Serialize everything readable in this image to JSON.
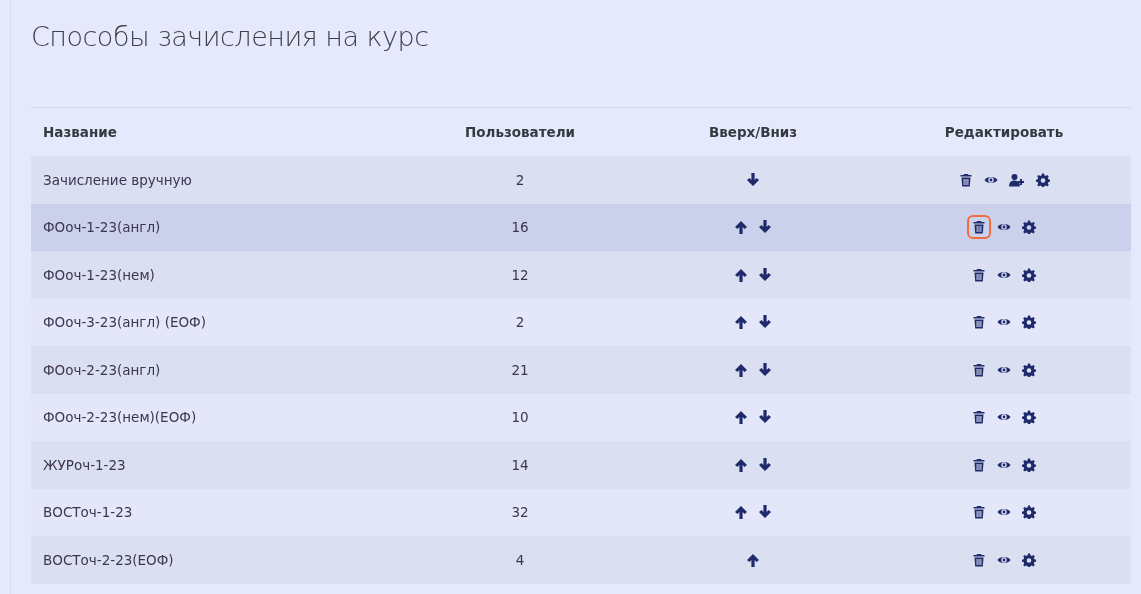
{
  "page_title": "Способы зачисления на курс",
  "table": {
    "columns": [
      "Название",
      "Пользователи",
      "Вверх/Вниз",
      "Редактировать"
    ],
    "rows": [
      {
        "name": "Зачисление вручную",
        "users": "2",
        "hovered": false,
        "moves": [
          {
            "kind": "down"
          }
        ],
        "actions": [
          {
            "kind": "delete",
            "highlighted": false
          },
          {
            "kind": "view",
            "highlighted": false
          },
          {
            "kind": "enrol",
            "highlighted": false
          },
          {
            "kind": "settings",
            "highlighted": false
          }
        ]
      },
      {
        "name": "ФОоч-1-23(англ)",
        "users": "16",
        "hovered": true,
        "moves": [
          {
            "kind": "up"
          },
          {
            "kind": "down"
          }
        ],
        "actions": [
          {
            "kind": "delete",
            "highlighted": true
          },
          {
            "kind": "view",
            "highlighted": false
          },
          {
            "kind": "settings",
            "highlighted": false
          }
        ]
      },
      {
        "name": "ФОоч-1-23(нем)",
        "users": "12",
        "hovered": false,
        "moves": [
          {
            "kind": "up"
          },
          {
            "kind": "down"
          }
        ],
        "actions": [
          {
            "kind": "delete",
            "highlighted": false
          },
          {
            "kind": "view",
            "highlighted": false
          },
          {
            "kind": "settings",
            "highlighted": false
          }
        ]
      },
      {
        "name": "ФОоч-3-23(англ) (ЕОФ)",
        "users": "2",
        "hovered": false,
        "moves": [
          {
            "kind": "up"
          },
          {
            "kind": "down"
          }
        ],
        "actions": [
          {
            "kind": "delete",
            "highlighted": false
          },
          {
            "kind": "view",
            "highlighted": false
          },
          {
            "kind": "settings",
            "highlighted": false
          }
        ]
      },
      {
        "name": "ФОоч-2-23(англ)",
        "users": "21",
        "hovered": false,
        "moves": [
          {
            "kind": "up"
          },
          {
            "kind": "down"
          }
        ],
        "actions": [
          {
            "kind": "delete",
            "highlighted": false
          },
          {
            "kind": "view",
            "highlighted": false
          },
          {
            "kind": "settings",
            "highlighted": false
          }
        ]
      },
      {
        "name": "ФОоч-2-23(нем)(ЕОФ)",
        "users": "10",
        "hovered": false,
        "moves": [
          {
            "kind": "up"
          },
          {
            "kind": "down"
          }
        ],
        "actions": [
          {
            "kind": "delete",
            "highlighted": false
          },
          {
            "kind": "view",
            "highlighted": false
          },
          {
            "kind": "settings",
            "highlighted": false
          }
        ]
      },
      {
        "name": "ЖУРоч-1-23",
        "users": "14",
        "hovered": false,
        "moves": [
          {
            "kind": "up"
          },
          {
            "kind": "down"
          }
        ],
        "actions": [
          {
            "kind": "delete",
            "highlighted": false
          },
          {
            "kind": "view",
            "highlighted": false
          },
          {
            "kind": "settings",
            "highlighted": false
          }
        ]
      },
      {
        "name": "ВОСТоч-1-23",
        "users": "32",
        "hovered": false,
        "moves": [
          {
            "kind": "up"
          },
          {
            "kind": "down"
          }
        ],
        "actions": [
          {
            "kind": "delete",
            "highlighted": false
          },
          {
            "kind": "view",
            "highlighted": false
          },
          {
            "kind": "settings",
            "highlighted": false
          }
        ]
      },
      {
        "name": "ВОСТоч-2-23(ЕОФ)",
        "users": "4",
        "hovered": false,
        "moves": [
          {
            "kind": "up"
          }
        ],
        "actions": [
          {
            "kind": "delete",
            "highlighted": false
          },
          {
            "kind": "view",
            "highlighted": false
          },
          {
            "kind": "settings",
            "highlighted": false
          }
        ]
      }
    ]
  }
}
